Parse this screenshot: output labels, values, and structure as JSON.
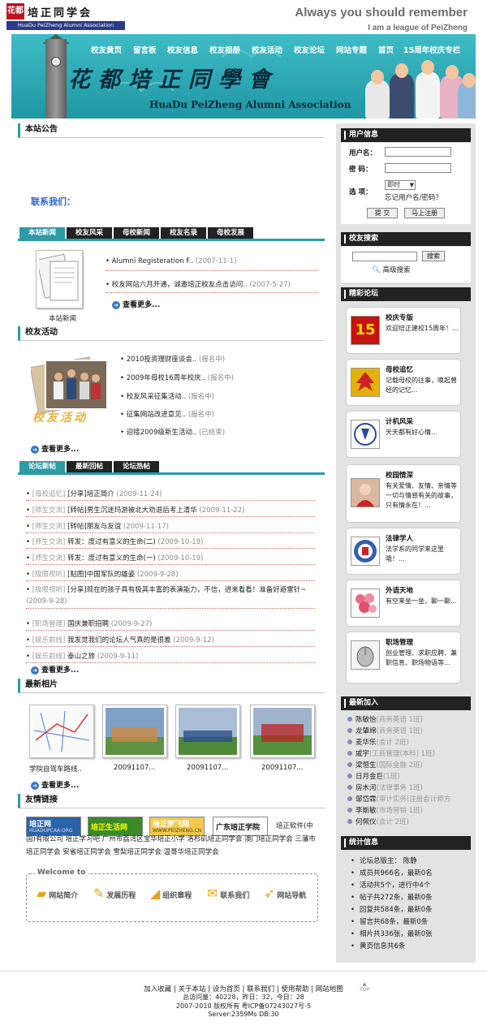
{
  "header": {
    "logo_mark": "花都",
    "logo_cn": "培正同学会",
    "logo_en": "HuaDu PeiZheng Alumni Association",
    "slogan1": "Always you should remember",
    "slogan2": "I am a league of PeiZheng"
  },
  "nav": [
    "校友黄页",
    "留言板",
    "校友信息",
    "校友相册",
    "校友活动",
    "校友论坛",
    "网站专题",
    "首页",
    "15周年校庆专栏"
  ],
  "banner": {
    "title_cn": "花都培正同學會",
    "title_en": "HuaDu PeiZheng Alumni Association"
  },
  "announcement": {
    "title": "本站公告",
    "contact": "联系我们："
  },
  "news": {
    "tabs": [
      "本站新闻",
      "校友风采",
      "母校新闻",
      "校友名录",
      "母校发展"
    ],
    "photo_caption": "本站新闻",
    "items": [
      {
        "text": "Alumni Registeration F..",
        "date": "(2007-11-1)"
      },
      {
        "text": "校友网站六月开通，诚邀培正校友点击访问..",
        "date": "(2007-5-27)"
      }
    ],
    "more": "查看更多..."
  },
  "activities": {
    "title": "校友活动",
    "photo_text": "校友活动",
    "items": [
      {
        "text": "2010投资理财座谈会..",
        "status": "(报名中)"
      },
      {
        "text": "2009年母校16周年校庆..",
        "status": "(报名中)"
      },
      {
        "text": "校友风采征集活动..",
        "status": "(报名中)"
      },
      {
        "text": "征集网站改进意见..",
        "status": "(报名中)"
      },
      {
        "text": "迎接2009级新生活动..",
        "status": "(已结束)"
      }
    ],
    "more": "查看更多..."
  },
  "forum": {
    "tabs": [
      "论坛新帖",
      "最新回帖",
      "论坛热帖"
    ],
    "items": [
      {
        "cat": "[母校追忆]",
        "text": "[分享]培正简介",
        "date": "(2009-11-24)"
      },
      {
        "cat": "[师生交流]",
        "text": "[转帖]男生沉迷玛游被北大劝退后考上清华",
        "date": "(2009-11-22)"
      },
      {
        "cat": "[师生交流]",
        "text": "[转帖]朋友与友谊",
        "date": "(2009-11-17)"
      },
      {
        "cat": "[师生交流]",
        "text": "转发：度过有意义的生命(二)",
        "date": "(2009-10-19)"
      },
      {
        "cat": "[师生交流]",
        "text": "转发：度过有意义的生命(一)",
        "date": "(2009-10-19)"
      },
      {
        "cat": "[极限视听]",
        "text": "[贴图]中国军队的雄姿",
        "date": "(2009-9-28)"
      },
      {
        "cat": "[极限视听]",
        "text": "[分享]现在的孩子具有极其丰富的表演能力，不信，进来看看！准备好避雷针~",
        "date": "(2009-9-28)"
      },
      {
        "cat": "[职场管理]",
        "text": "国庆兼职招聘",
        "date": "(2009-9-27)"
      },
      {
        "cat": "[娱乐前线]",
        "text": "我发觉我们的论坛人气真的是很差",
        "date": "(2009-9-12)"
      },
      {
        "cat": "[娱乐前线]",
        "text": "泰山之旅",
        "date": "(2009-9-11)"
      }
    ],
    "more": "查看更多..."
  },
  "photos": {
    "title": "最新相片",
    "items": [
      "学院自驾车路线..",
      "20091107...",
      "20091107...",
      "20091107..."
    ],
    "more": "查看更多..."
  },
  "links": {
    "title": "友情链接",
    "logos": [
      "培正网",
      "培正生活网",
      "培正梦飞翔",
      "广东培正学院"
    ],
    "logo_urls": [
      "HUADUPCAA.ORG",
      "",
      "WWW.PEIZHENG.CN",
      ""
    ],
    "text": "培正软件(中国)有限公司  培正学习吧  广州市荔湾区宝华培正小学  洛杉矶培正同学会  澳门培正同学会  三藩市培正同学会  安省培正同学会  雪梨培正同学会  温哥华培正同学会"
  },
  "welcome": {
    "title": "Welcome to",
    "items": [
      "网站简介",
      "发展历程",
      "组织章程",
      "联系我们",
      "网站导航"
    ]
  },
  "user": {
    "title": "用户信息",
    "username_label": "用户名：",
    "password_label": "密  码：",
    "option_label": "选  项：",
    "option_value": "即时",
    "forgot": "忘记用户名/密码？",
    "submit": "提 交",
    "register": "马上注册"
  },
  "search": {
    "title": "校友搜索",
    "button": "搜索",
    "advanced": "高级搜索"
  },
  "featured": {
    "title": "精彩论坛",
    "cards": [
      {
        "name": "校庆专版",
        "desc": "欢迎培正建校15周年！...",
        "icon": "15"
      },
      {
        "name": "母校追忆",
        "desc": "记载母校的往事，唤起曾经的记忆...",
        "icon": "leaf"
      },
      {
        "name": "计机风采",
        "desc": "天天都有好心情...",
        "icon": "logo"
      },
      {
        "name": "校园情深",
        "desc": "有关爱情、友情、亲情等一切与情感有关的故事，只有情永在！...",
        "icon": "girl"
      },
      {
        "name": "法律学人",
        "desc": "法学系的同学来这里哦！...",
        "icon": "badge"
      },
      {
        "name": "外语天地",
        "desc": "有空来坐一坐，聊一聊...",
        "icon": "flower"
      },
      {
        "name": "职场管理",
        "desc": "创业管理、求职应聘、兼职信息、职场物语等...",
        "icon": "mouse"
      }
    ]
  },
  "newcomers": {
    "title": "最新加入",
    "items": [
      {
        "name": "陈敏怡",
        "info": "(商务英语 1班)"
      },
      {
        "name": "龙肇绵",
        "info": "(商务英语 1班)"
      },
      {
        "name": "麦华乐",
        "info": "(会计 2班)"
      },
      {
        "name": "戚宇",
        "info": "(工商管理(本科) 1班)"
      },
      {
        "name": "梁恒生",
        "info": "(国际金融 2班)"
      },
      {
        "name": "日月金巨",
        "info": "(1班)"
      },
      {
        "name": "房木河",
        "info": "(法律事务 1班)"
      },
      {
        "name": "邹岱霖",
        "info": "(审计实务(注册会计师方"
      },
      {
        "name": "李斯敏",
        "info": "(市场营销 1班)"
      },
      {
        "name": "何佩仪",
        "info": "(会计 2班)"
      }
    ]
  },
  "stats": {
    "title": "统计信息",
    "items": [
      "论坛总版主： 陈静",
      "成员共966名，最新0名",
      "活动共5个，进行中4个",
      "帖子共272条，最新0条",
      "回复共584条，最新0条",
      "留言共68条，最新0条",
      "相片共336张，最新0张",
      "黄页信息共6条"
    ]
  },
  "footer": {
    "links": [
      "加入收藏",
      "关于本站",
      "设为首页",
      "联系我们",
      "使用帮助",
      "网站地图"
    ],
    "top": "TOP",
    "stats": "总访问量：40228，昨日：32，今日：28",
    "copy": "2007-2010 版权所有 粤ICP备07243027号-5",
    "server": "Server:2359Ms  DB:30"
  }
}
